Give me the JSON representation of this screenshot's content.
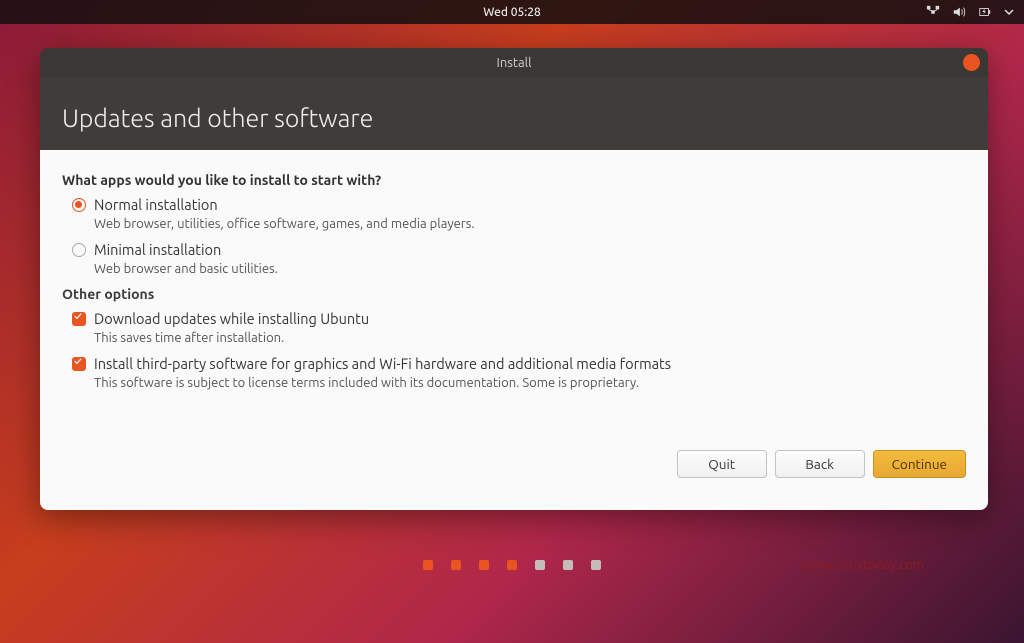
{
  "topbar": {
    "datetime": "Wed 05:28"
  },
  "window": {
    "title": "Install",
    "heading": "Updates and other software"
  },
  "content": {
    "question": "What apps would you like to install to start with?",
    "options": {
      "normal": {
        "label": "Normal installation",
        "hint": "Web browser, utilities, office software, games, and media players."
      },
      "minimal": {
        "label": "Minimal installation",
        "hint": "Web browser and basic utilities."
      }
    },
    "other_title": "Other options",
    "other": {
      "updates": {
        "label": "Download updates while installing Ubuntu",
        "hint": "This saves time after installation."
      },
      "thirdparty": {
        "label": "Install third-party software for graphics and Wi-Fi hardware and additional media formats",
        "hint": "This software is subject to license terms included with its documentation. Some is proprietary."
      }
    }
  },
  "buttons": {
    "quit": "Quit",
    "back": "Back",
    "continue": "Continue"
  },
  "watermark": "www.linuxtoday.com"
}
